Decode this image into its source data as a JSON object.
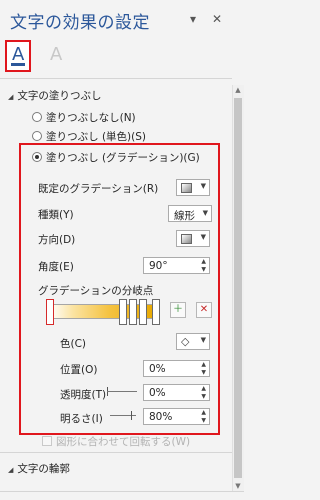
{
  "pane": {
    "title": "文字の効果の設定",
    "pin_glyph": "▾",
    "close_glyph": "✕"
  },
  "tabs": [
    {
      "label": "A",
      "icon": "text-fill-outline-icon",
      "selected": true
    },
    {
      "label": "A",
      "icon": "text-effects-icon",
      "selected": false
    }
  ],
  "fill_section": {
    "header": "文字の塗りつぶし",
    "expand_glyph": "◢",
    "options": [
      {
        "label": "塗りつぶしなし(N)",
        "selected": false
      },
      {
        "label": "塗りつぶし (単色)(S)",
        "selected": false
      },
      {
        "label": "塗りつぶし (グラデーション)(G)",
        "selected": true
      }
    ]
  },
  "gradient": {
    "preset_label": "既定のグラデーション(R)",
    "type_label": "種類(Y)",
    "type_value": "線形",
    "direction_label": "方向(D)",
    "angle_label": "角度(E)",
    "angle_value": "90°",
    "stops_label": "グラデーションの分岐点",
    "add_stop_icon": "add-gradient-stop-icon",
    "remove_stop_icon": "remove-gradient-stop-icon",
    "color_label": "色(C)",
    "position_label": "位置(O)",
    "position_value": "0%",
    "transparency_label": "透明度(T)",
    "transparency_value": "0%",
    "brightness_label": "明るさ(I)",
    "brightness_value": "80%",
    "rotate_label": "図形に合わせて回転する(W)",
    "rotate_checked": false
  },
  "outline_section": {
    "header": "文字の輪郭",
    "expand_glyph": "◢"
  },
  "colors": {
    "accent": "#2b579a",
    "highlight": "#e0161d",
    "gradient_start": "#ffffff",
    "gradient_end": "#e8a900"
  }
}
